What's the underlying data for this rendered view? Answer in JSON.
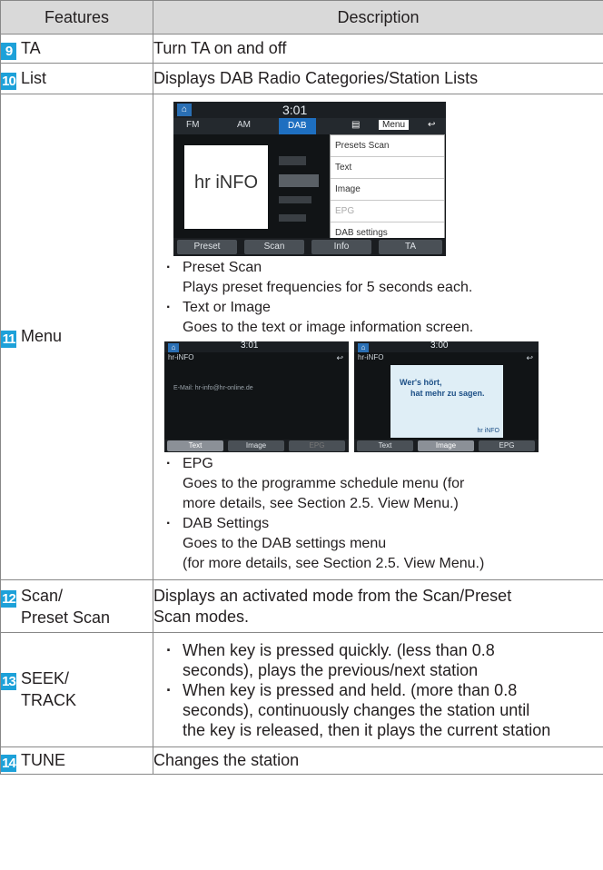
{
  "header": {
    "features": "Features",
    "description": "Description"
  },
  "rows": {
    "ta": {
      "num": "9",
      "feature": "TA",
      "desc": "Turn TA on and off"
    },
    "list": {
      "num": "10",
      "feature": "List",
      "desc": "Displays DAB Radio Categories/Station Lists"
    },
    "menu": {
      "num": "11",
      "feature": "Menu",
      "items": [
        {
          "title": "Preset Scan",
          "text": "Plays preset frequencies for 5 seconds each."
        },
        {
          "title": "Text or Image",
          "text": "Goes to the text or image information screen."
        },
        {
          "title": "EPG",
          "text1": "Goes to the programme schedule menu (for",
          "text2": "more details, see Section 2.5. View Menu.)"
        },
        {
          "title": "DAB Settings",
          "text1": "Goes to the DAB settings menu",
          "text2": "(for more details, see Section 2.5. View Menu.)"
        }
      ],
      "screen_main": {
        "time": "3:01",
        "tabs": [
          "FM",
          "AM",
          "DAB"
        ],
        "menu_btn": "Menu",
        "station_short": "hr iNFO",
        "popup": [
          "Presets Scan",
          "Text",
          "Image",
          "EPG",
          "DAB settings"
        ],
        "buttons": [
          "Preset",
          "Scan",
          "Info",
          "TA"
        ]
      },
      "screen_text": {
        "time": "3:01",
        "station": "hr-iNFO",
        "body": "E-Mail: hr-info@hr-online.de",
        "buttons": [
          "Text",
          "Image",
          "EPG"
        ]
      },
      "screen_image": {
        "time": "3:00",
        "station": "hr-iNFO",
        "slogan1": "Wer's hört,",
        "slogan2": "hat mehr zu sagen.",
        "brand": "hr iNFO",
        "buttons": [
          "Text",
          "Image",
          "EPG"
        ]
      }
    },
    "scan": {
      "num": "12",
      "feature1": "Scan/",
      "feature2": "Preset Scan",
      "desc1": "Displays an activated mode from the Scan/Preset",
      "desc2": "Scan modes."
    },
    "seek": {
      "num": "13",
      "feature1": "SEEK/",
      "feature2": "TRACK",
      "items": [
        {
          "l1": "When key is pressed quickly. (less than 0.8",
          "l2": "seconds), plays the previous/next station"
        },
        {
          "l1": "When key is pressed and held. (more than 0.8",
          "l2": "seconds), continuously changes the station until",
          "l3": "the key is released, then it plays the current station"
        }
      ]
    },
    "tune": {
      "num": "14",
      "feature": "TUNE",
      "desc": "Changes the station"
    }
  },
  "colors": {
    "accent": "#1da1d9",
    "header_bg": "#d9d9d9",
    "border": "#888888",
    "screen_active_tab": "#1e6fc0"
  }
}
